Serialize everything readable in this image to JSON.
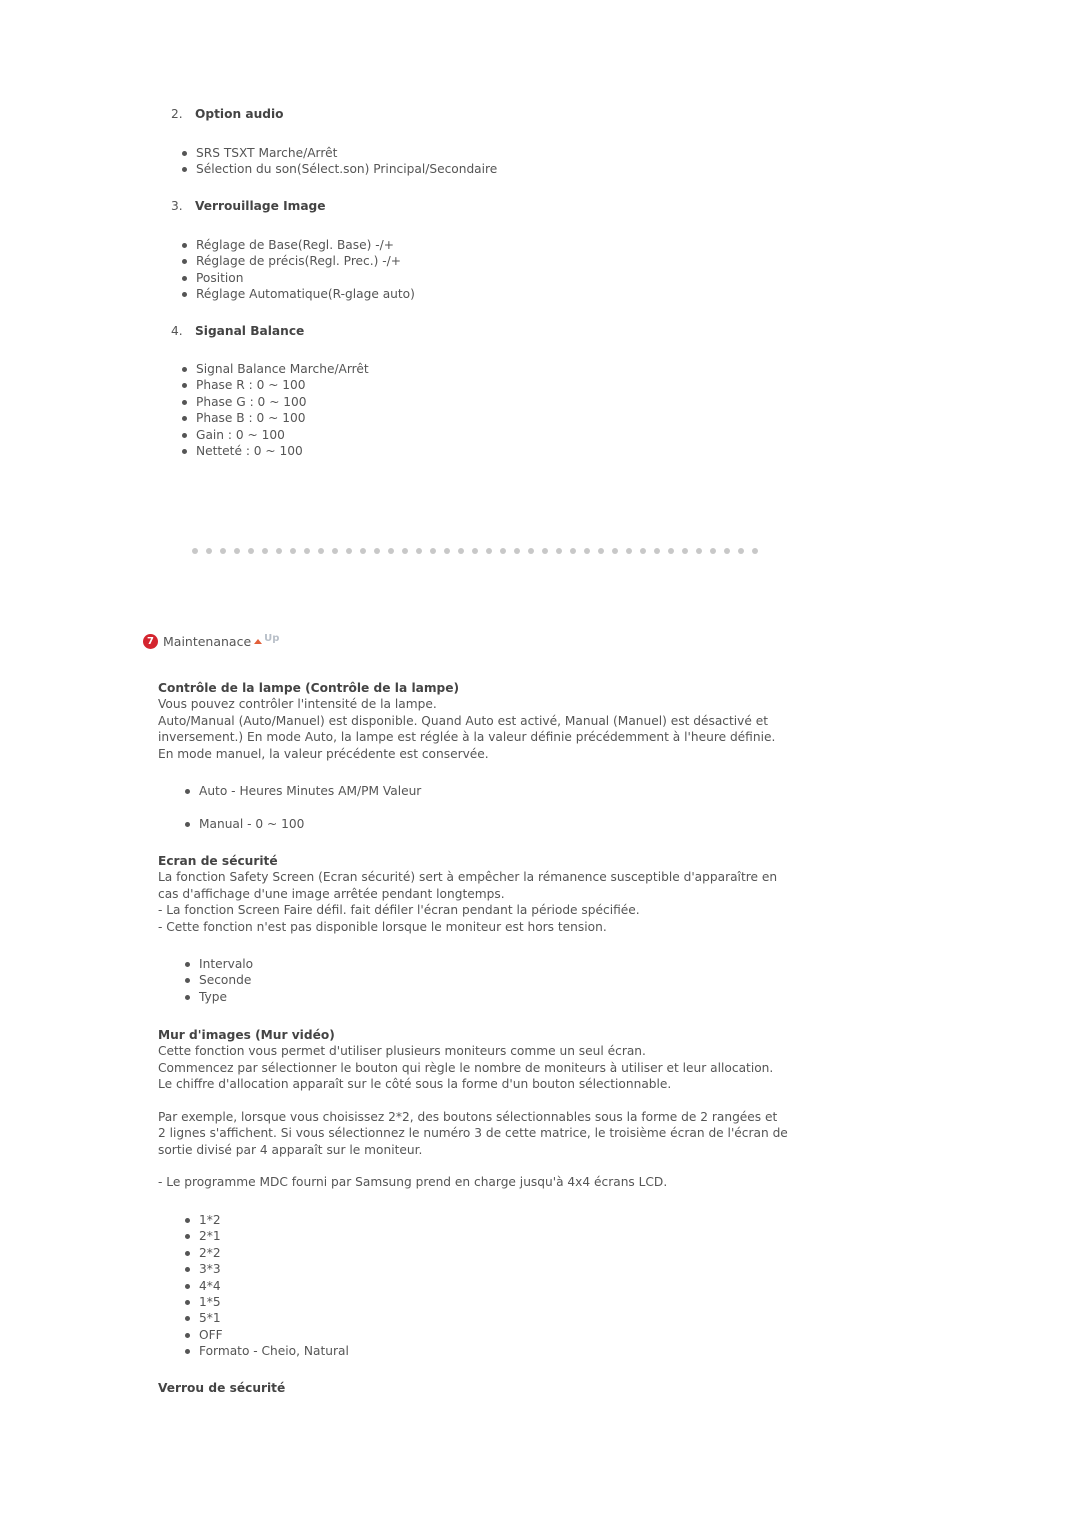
{
  "numbered_sections": [
    {
      "number": "2.",
      "title": "Option audio",
      "items": [
        "SRS TSXT Marche/Arrêt",
        "Sélection du son(Sélect.son) Principal/Secondaire"
      ]
    },
    {
      "number": "3.",
      "title": "Verrouillage Image",
      "items": [
        "Réglage de Base(Regl. Base) -/+",
        "Réglage de précis(Regl. Prec.) -/+",
        "Position",
        "Réglage Automatique(R-glage auto)"
      ]
    },
    {
      "number": "4.",
      "title": "Siganal Balance",
      "items": [
        "Signal Balance Marche/Arrêt",
        "Phase R : 0 ~ 100",
        "Phase G : 0 ~ 100",
        "Phase B : 0 ~ 100",
        "Gain : 0 ~ 100",
        "Netteté : 0 ~ 100"
      ]
    }
  ],
  "maintenance": {
    "icon_number": "7",
    "title": "Maintenanace",
    "up_label": "Up",
    "colors": {
      "icon_bg": "#d4252f",
      "up_arrow": "#e2603a",
      "up_text": "#b8bfc8"
    }
  },
  "lamp": {
    "heading": "Contrôle de la lampe (Contrôle de la lampe)",
    "lines": [
      "Vous pouvez contrôler l'intensité de la lampe.",
      "Auto/Manual (Auto/Manuel) est disponible. Quand Auto est activé, Manual (Manuel) est désactivé et",
      "inversement.) En mode Auto, la lampe est réglée à la valeur définie précédemment à l'heure définie.",
      "En mode manuel, la valeur précédente est conservée."
    ],
    "items": [
      "Auto - Heures Minutes AM/PM Valeur",
      "Manual - 0 ~ 100"
    ]
  },
  "safety_screen": {
    "heading": "Ecran de sécurité",
    "lines": [
      "La fonction Safety Screen (Ecran sécurité) sert à empêcher la rémanence susceptible d'apparaître en",
      "cas d'affichage d'une image arrêtée pendant longtemps.",
      "- La fonction Screen Faire défil. fait défiler l'écran pendant la période spécifiée.",
      "- Cette fonction n'est pas disponible lorsque le moniteur est hors tension."
    ],
    "items": [
      "Intervalo",
      "Seconde",
      "Type"
    ]
  },
  "video_wall": {
    "heading": "Mur d'images (Mur vidéo)",
    "lines": [
      "Cette fonction vous permet d'utiliser plusieurs moniteurs comme un seul écran.",
      "Commencez par sélectionner le bouton qui règle le nombre de moniteurs à utiliser et leur allocation.",
      "Le chiffre d'allocation apparaît sur le côté sous la forme d'un bouton sélectionnable."
    ],
    "example_lines": [
      "Par exemple, lorsque vous choisissez 2*2, des boutons sélectionnables sous la forme de 2 rangées et",
      "2 lignes s'affichent. Si vous sélectionnez le numéro 3 de cette matrice, le troisième écran de l'écran de",
      "sortie divisé par 4 apparaît sur le moniteur."
    ],
    "note": "- Le programme MDC fourni par Samsung prend en charge jusqu'à 4x4 écrans LCD.",
    "items": [
      "1*2",
      "2*1",
      "2*2",
      "3*3",
      "4*4",
      "1*5",
      "5*1",
      "OFF",
      "Formato - Cheio, Natural"
    ]
  },
  "security_lock": {
    "heading": "Verrou de sécurité"
  }
}
